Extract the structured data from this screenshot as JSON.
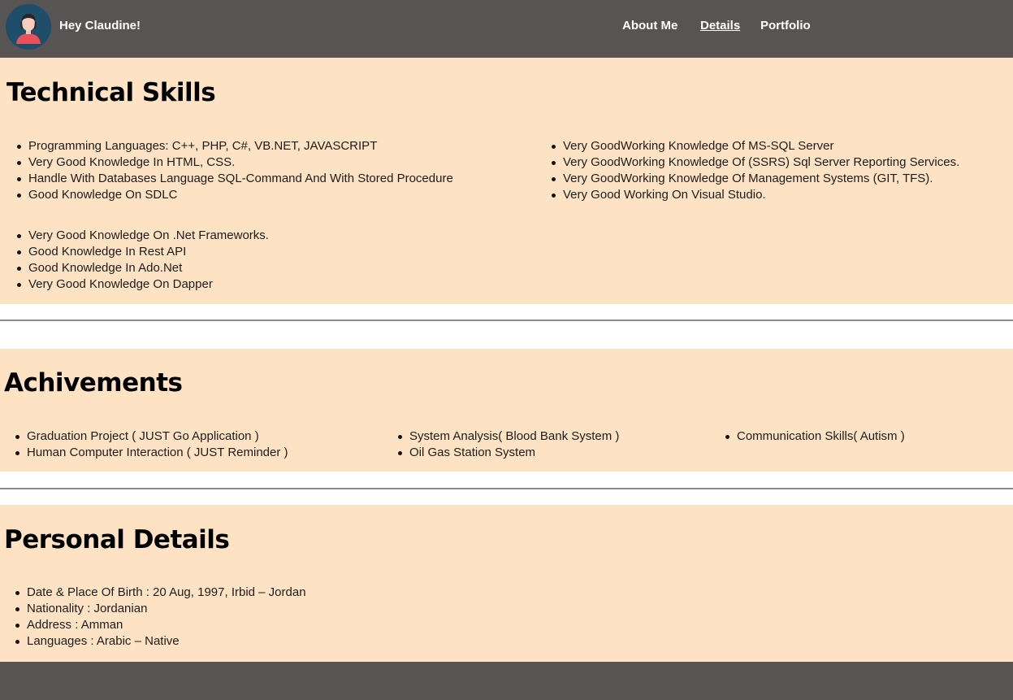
{
  "nav": {
    "greeting": "Hey Claudine!",
    "links": [
      {
        "label": "About Me",
        "active": false
      },
      {
        "label": "Details",
        "active": true
      },
      {
        "label": "Portfolio",
        "active": false
      }
    ]
  },
  "technical_skills": {
    "title": "Technical Skills",
    "col1_group1": [
      "Programming Languages: C++, PHP, C#, VB.NET, JAVASCRIPT",
      "Very Good Knowledge In HTML, CSS.",
      "Handle With Databases Language SQL-Command And With Stored Procedure",
      "Good Knowledge On SDLC"
    ],
    "col1_group2": [
      "Very Good Knowledge On .Net Frameworks.",
      "Good Knowledge In Rest API",
      "Good Knowledge In Ado.Net",
      "Very Good Knowledge On Dapper"
    ],
    "col2": [
      "Very GoodWorking Knowledge Of MS-SQL Server",
      "Very GoodWorking Knowledge Of (SSRS) Sql Server Reporting Services.",
      "Very GoodWorking Knowledge Of Management Systems (GIT, TFS).",
      "Very Good Working On Visual Studio."
    ]
  },
  "achievements": {
    "title": "Achivements",
    "col1": [
      "Graduation Project ( JUST Go Application )",
      "Human Computer Interaction ( JUST Reminder )"
    ],
    "col2": [
      "System Analysis( Blood Bank System )",
      "Oil Gas Station System"
    ],
    "col3": [
      "Communication Skills( Autism )"
    ]
  },
  "personal_details": {
    "title": "Personal Details",
    "items": [
      "Date & Place Of Birth : 20 Aug, 1997, Irbid – Jordan",
      "Nationality : Jordanian",
      "Address : Amman",
      "Languages : Arabic – Native"
    ]
  },
  "colors": {
    "nav_bg": "#585454",
    "section_bg": "#fde3c4",
    "avatar_bg": "#1f4e6a",
    "avatar_shirt": "#e8505b"
  }
}
